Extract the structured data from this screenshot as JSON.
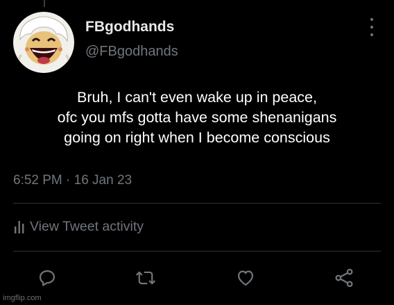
{
  "tweet": {
    "display_name": "FBgodhands",
    "handle": "@FBgodhands",
    "text_lines": [
      "Bruh, I can't even wake up in peace,",
      "ofc you mfs gotta have some shenanigans",
      "going on right when I become conscious"
    ],
    "timestamp": "6:52 PM · 16 Jan 23",
    "activity_label": "View Tweet activity"
  },
  "icons": {
    "more": "more-vertical-icon",
    "activity": "bar-chart-icon",
    "reply": "reply-icon",
    "retweet": "retweet-icon",
    "like": "heart-icon",
    "share": "share-icon"
  },
  "colors": {
    "background": "#000000",
    "primary_text": "#e7e9ea",
    "secondary_text": "#71767b",
    "divider": "#2f3336"
  },
  "watermark": "imgflip.com"
}
